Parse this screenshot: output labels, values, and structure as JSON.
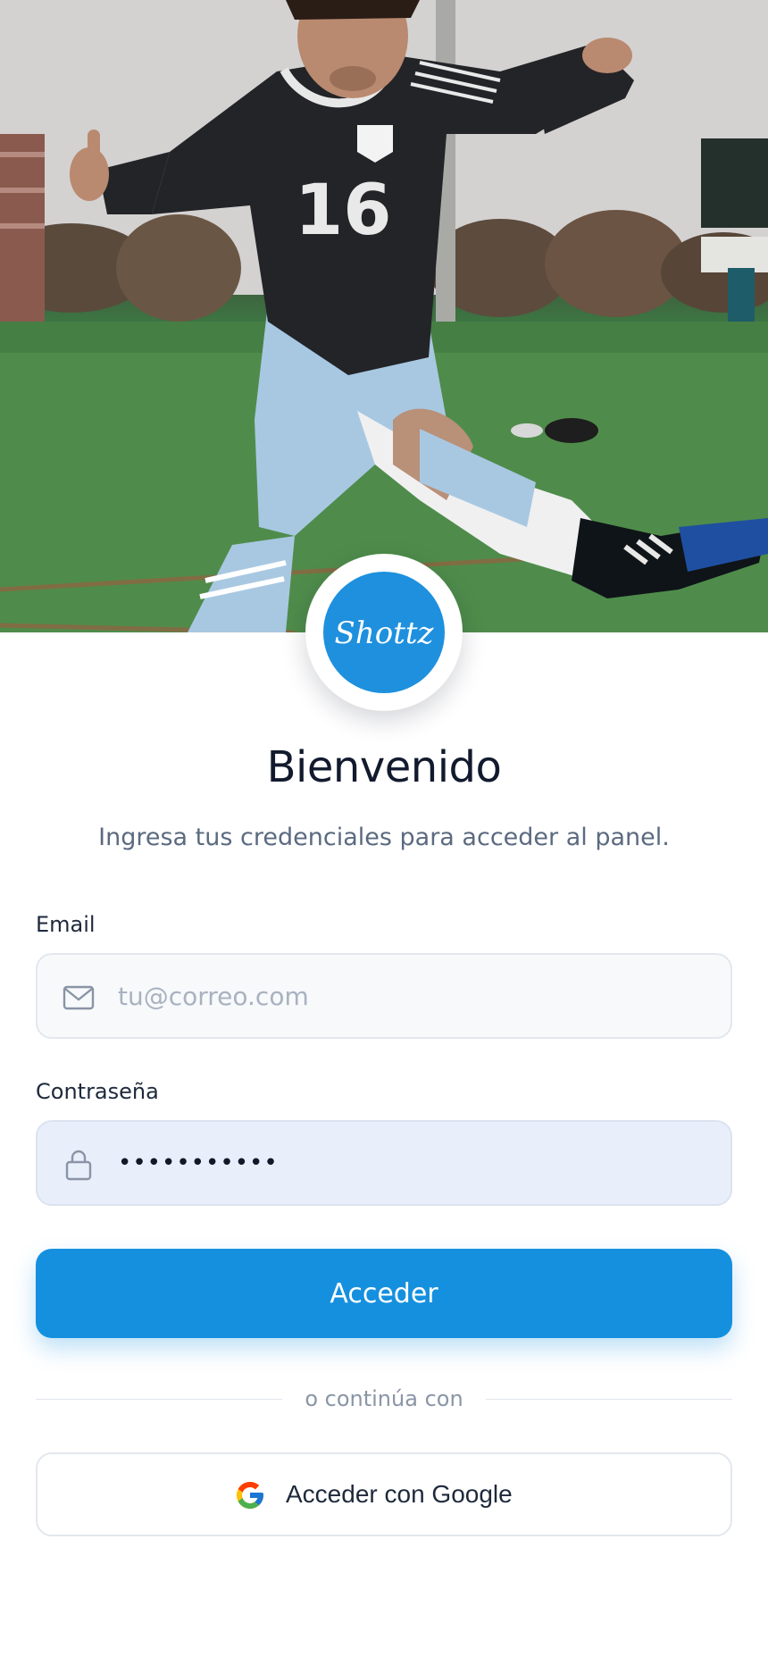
{
  "brand": {
    "name": "Shottz",
    "accent_color": "#1590df"
  },
  "hero": {
    "image_alt": "soccer player kicking"
  },
  "header": {
    "title": "Bienvenido",
    "subtitle": "Ingresa tus credenciales para acceder al panel."
  },
  "form": {
    "email": {
      "label": "Email",
      "placeholder": "tu@correo.com",
      "value": "",
      "icon": "mail-icon"
    },
    "password": {
      "label": "Contraseña",
      "value": "•••••••••••",
      "icon": "lock-icon"
    },
    "submit_label": "Acceder"
  },
  "divider_text": "o continúa con",
  "google_button": {
    "label": "Acceder con Google",
    "icon": "google-icon"
  }
}
